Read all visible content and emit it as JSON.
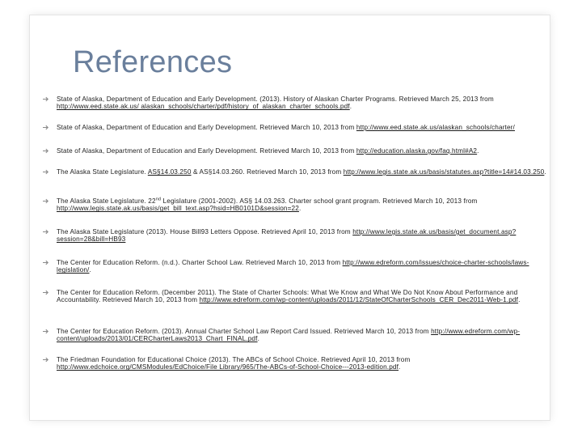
{
  "slide": {
    "title": "References"
  },
  "references": [
    {
      "parts": [
        {
          "t": "State of Alaska, Department of Education and Early Development. (2013). History of Alaskan Charter Programs. Retrieved March 25, 2013 from "
        },
        {
          "t": "http://www.eed.state.ak.us/ alaskan_schools/charter/pdf/history_of_alaskan_charter_schools.pdf",
          "link": true
        },
        {
          "t": "."
        }
      ]
    },
    {
      "parts": [
        {
          "t": "State of Alaska, Department of Education and Early Development. Retrieved March 10, 2013 from "
        },
        {
          "t": "http://www.eed.state.ak.us/alaskan_schools/charter/",
          "link": true
        }
      ]
    },
    {
      "parts": [
        {
          "t": "State of Alaska, Department of Education and Early Development. Retrieved March 10, 2013 from "
        },
        {
          "t": "http://education.alaska.gov/faq.html#A2",
          "link": true
        },
        {
          "t": "."
        }
      ]
    },
    {
      "parts": [
        {
          "t": "The Alaska State Legislature. "
        },
        {
          "t": "AS§14.03.250",
          "link": true
        },
        {
          "t": " & AS§14.03.260. Retrieved March 10, 2013 from "
        },
        {
          "t": "http://www.legis.state.ak.us/basis/statutes.asp?title=14#14.03.250",
          "link": true
        },
        {
          "t": "."
        }
      ]
    },
    {
      "parts": [
        {
          "t": "The Alaska State Legislature. 22"
        },
        {
          "t": "nd",
          "sup": true
        },
        {
          "t": " Legislature (2001-2002). AS§ 14.03.263. Charter school grant program. Retrieved March 10, 2013 from "
        },
        {
          "t": "http://www.legis.state.ak.us/basis/get_bill_text.asp?hsid=HB0101D&session=22",
          "link": true
        },
        {
          "t": "."
        }
      ]
    },
    {
      "parts": [
        {
          "t": "The Alaska State Legislature (2013). House Bill93 Letters Oppose. Retrieved April 10, 2013 from "
        },
        {
          "t": "http://www.legis.state.ak.us/basis/get_document.asp?session=28&bill=HB93",
          "link": true
        }
      ]
    },
    {
      "parts": [
        {
          "t": "The Center for Education Reform. (n.d.). Charter School Law. Retrieved March 10, 2013 from "
        },
        {
          "t": "http://www.edreform.com/issues/choice-charter-schools/laws-legislation/",
          "link": true
        },
        {
          "t": "."
        }
      ]
    },
    {
      "parts": [
        {
          "t": "The Center for Education Reform. (December 2011). The State of Charter Schools: What We Know and What We Do Not Know About Performance and Accountability. Retrieved March 10, 2013 from "
        },
        {
          "t": "http://www.edreform.com/wp-content/uploads/2011/12/StateOfCharterSchools_CER_Dec2011-Web-1.pdf",
          "link": true
        },
        {
          "t": "."
        }
      ]
    },
    {
      "parts": [
        {
          "t": "The Center for Education Reform. (2013). Annual Charter School Law Report Card Issued. Retrieved March 10, 2013 from "
        },
        {
          "t": "http://www.edreform.com/wp-content/uploads/2013/01/CERCharterLaws2013_Chart_FINAL.pdf",
          "link": true
        },
        {
          "t": "."
        }
      ]
    },
    {
      "parts": [
        {
          "t": "The Friedman Foundation for Educational Choice (2013). The ABCs of School Choice. Retrieved April 10, 2013 from "
        },
        {
          "t": "http://www.edchoice.org/CMSModules/EdChoice/File Library/965/The-ABCs-of-School-Choice---2013-edition.pdf",
          "link": true
        },
        {
          "t": "."
        }
      ]
    }
  ],
  "bullet_icon": "arrow-bullet-icon",
  "colors": {
    "title": "#6a7f9c",
    "text": "#222222",
    "bullet": "#8a8a8a"
  }
}
